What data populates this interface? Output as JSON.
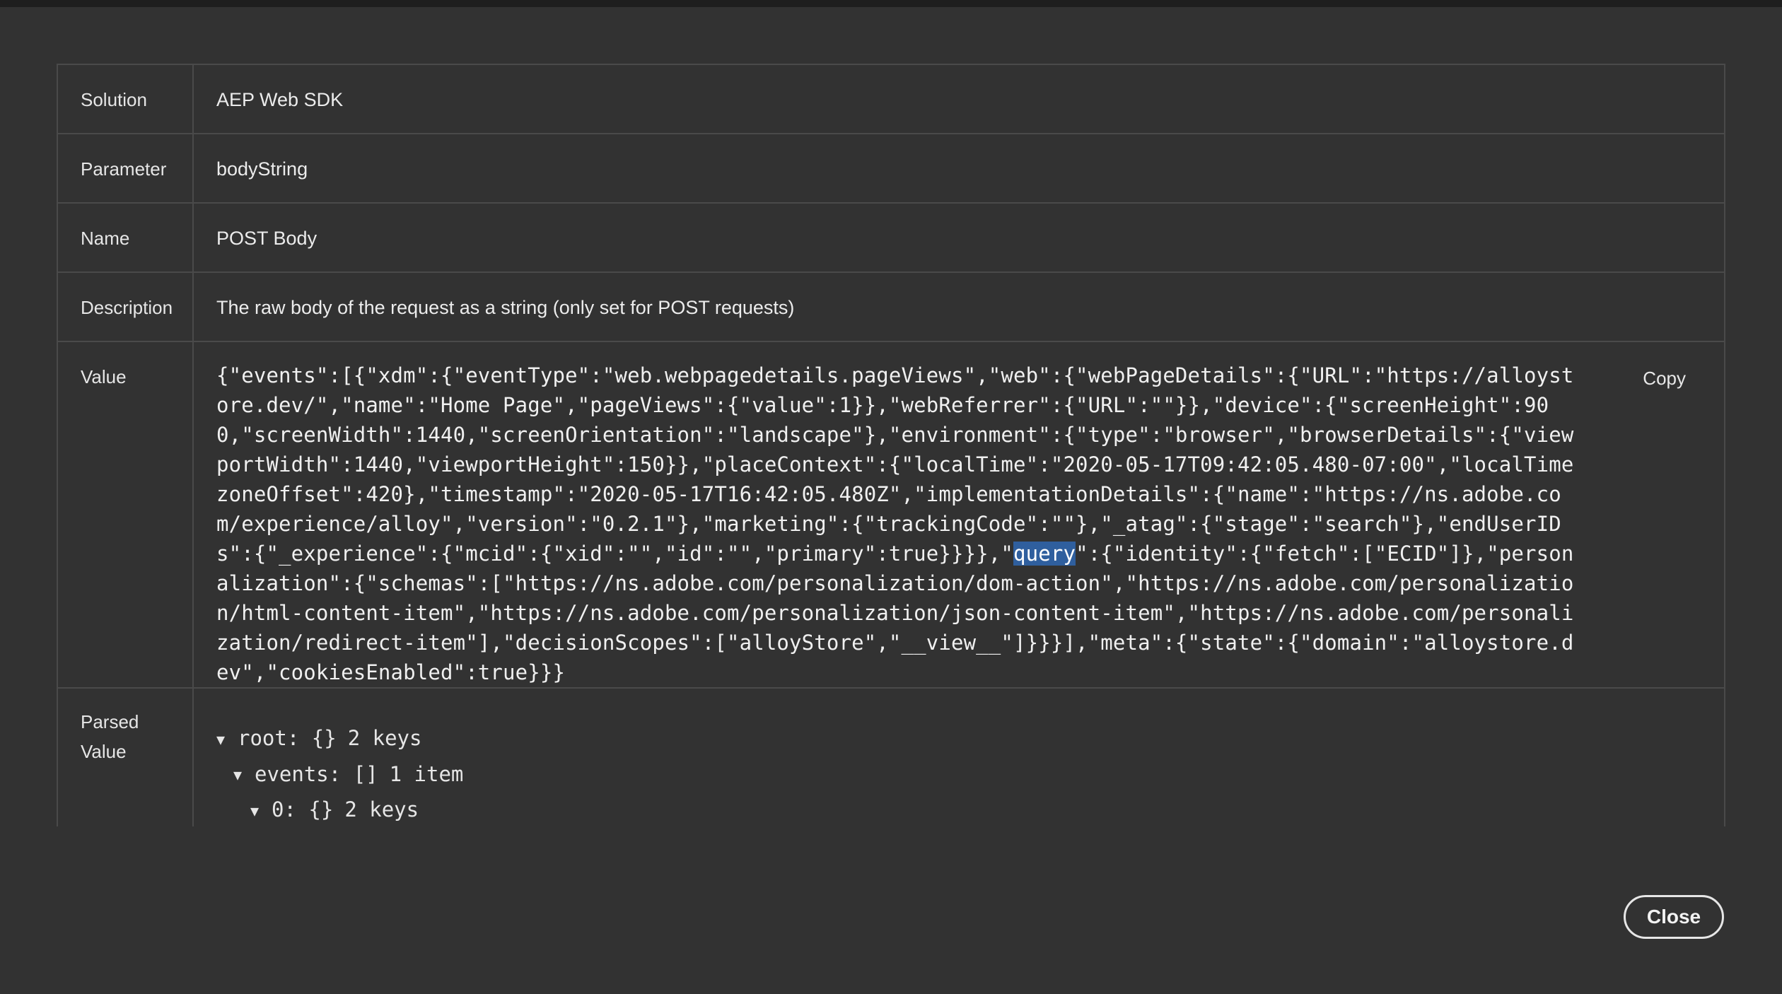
{
  "rows": {
    "solution": {
      "label": "Solution",
      "value": "AEP Web SDK"
    },
    "parameter": {
      "label": "Parameter",
      "value": "bodyString"
    },
    "name": {
      "label": "Name",
      "value": "POST Body"
    },
    "description": {
      "label": "Description",
      "value": "The raw body of the request as a string (only set for POST requests)"
    },
    "value": {
      "label": "Value",
      "raw_before": "{\"events\":[{\"xdm\":{\"eventType\":\"web.webpagedetails.pageViews\",\"web\":{\"webPageDetails\":{\"URL\":\"https://alloystore.dev/\",\"name\":\"Home Page\",\"pageViews\":{\"value\":1}},\"webReferrer\":{\"URL\":\"\"}},\"device\":{\"screenHeight\":900,\"screenWidth\":1440,\"screenOrientation\":\"landscape\"},\"environment\":{\"type\":\"browser\",\"browserDetails\":{\"viewportWidth\":1440,\"viewportHeight\":150}},\"placeContext\":{\"localTime\":\"2020-05-17T09:42:05.480-07:00\",\"localTimezoneOffset\":420},\"timestamp\":\"2020-05-17T16:42:05.480Z\",\"implementationDetails\":{\"name\":\"https://ns.adobe.com/experience/alloy\",\"version\":\"0.2.1\"},\"marketing\":{\"trackingCode\":\"\"},\"_atag\":{\"stage\":\"search\"},\"endUserIDs\":{\"_experience\":{\"mcid\":{\"xid\":\"\",\"id\":\"\",\"primary\":true}}}},\"",
      "raw_highlight": "query",
      "raw_after": "\":{\"identity\":{\"fetch\":[\"ECID\"]},\"personalization\":{\"schemas\":[\"https://ns.adobe.com/personalization/dom-action\",\"https://ns.adobe.com/personalization/html-content-item\",\"https://ns.adobe.com/personalization/json-content-item\",\"https://ns.adobe.com/personalization/redirect-item\"],\"decisionScopes\":[\"alloyStore\",\"__view__\"]}}}],\"meta\":{\"state\":{\"domain\":\"alloystore.dev\",\"cookiesEnabled\":true}}}",
      "copy_label": "Copy"
    },
    "parsed": {
      "label_line1": "Parsed",
      "label_line2": "Value",
      "tree": [
        {
          "caret": "▼",
          "key": "root:",
          "type": "{}",
          "count": "2 keys"
        },
        {
          "caret": "▼",
          "key": "events:",
          "type": "[]",
          "count": "1 item"
        },
        {
          "caret": "▼",
          "key": "0:",
          "type": "{}",
          "count": "2 keys"
        }
      ]
    }
  },
  "footer": {
    "close_label": "Close"
  },
  "colors": {
    "highlight": "#2f5f9e",
    "background": "#323232",
    "border": "#4a4a4a"
  }
}
